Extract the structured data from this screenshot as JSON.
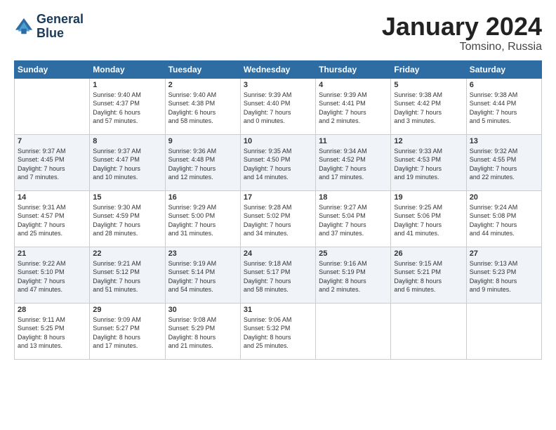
{
  "header": {
    "logo_line1": "General",
    "logo_line2": "Blue",
    "month": "January 2024",
    "location": "Tomsino, Russia"
  },
  "days_of_week": [
    "Sunday",
    "Monday",
    "Tuesday",
    "Wednesday",
    "Thursday",
    "Friday",
    "Saturday"
  ],
  "weeks": [
    [
      {
        "day": "",
        "info": ""
      },
      {
        "day": "1",
        "info": "Sunrise: 9:40 AM\nSunset: 4:37 PM\nDaylight: 6 hours\nand 57 minutes."
      },
      {
        "day": "2",
        "info": "Sunrise: 9:40 AM\nSunset: 4:38 PM\nDaylight: 6 hours\nand 58 minutes."
      },
      {
        "day": "3",
        "info": "Sunrise: 9:39 AM\nSunset: 4:40 PM\nDaylight: 7 hours\nand 0 minutes."
      },
      {
        "day": "4",
        "info": "Sunrise: 9:39 AM\nSunset: 4:41 PM\nDaylight: 7 hours\nand 2 minutes."
      },
      {
        "day": "5",
        "info": "Sunrise: 9:38 AM\nSunset: 4:42 PM\nDaylight: 7 hours\nand 3 minutes."
      },
      {
        "day": "6",
        "info": "Sunrise: 9:38 AM\nSunset: 4:44 PM\nDaylight: 7 hours\nand 5 minutes."
      }
    ],
    [
      {
        "day": "7",
        "info": "Sunrise: 9:37 AM\nSunset: 4:45 PM\nDaylight: 7 hours\nand 7 minutes."
      },
      {
        "day": "8",
        "info": "Sunrise: 9:37 AM\nSunset: 4:47 PM\nDaylight: 7 hours\nand 10 minutes."
      },
      {
        "day": "9",
        "info": "Sunrise: 9:36 AM\nSunset: 4:48 PM\nDaylight: 7 hours\nand 12 minutes."
      },
      {
        "day": "10",
        "info": "Sunrise: 9:35 AM\nSunset: 4:50 PM\nDaylight: 7 hours\nand 14 minutes."
      },
      {
        "day": "11",
        "info": "Sunrise: 9:34 AM\nSunset: 4:52 PM\nDaylight: 7 hours\nand 17 minutes."
      },
      {
        "day": "12",
        "info": "Sunrise: 9:33 AM\nSunset: 4:53 PM\nDaylight: 7 hours\nand 19 minutes."
      },
      {
        "day": "13",
        "info": "Sunrise: 9:32 AM\nSunset: 4:55 PM\nDaylight: 7 hours\nand 22 minutes."
      }
    ],
    [
      {
        "day": "14",
        "info": "Sunrise: 9:31 AM\nSunset: 4:57 PM\nDaylight: 7 hours\nand 25 minutes."
      },
      {
        "day": "15",
        "info": "Sunrise: 9:30 AM\nSunset: 4:59 PM\nDaylight: 7 hours\nand 28 minutes."
      },
      {
        "day": "16",
        "info": "Sunrise: 9:29 AM\nSunset: 5:00 PM\nDaylight: 7 hours\nand 31 minutes."
      },
      {
        "day": "17",
        "info": "Sunrise: 9:28 AM\nSunset: 5:02 PM\nDaylight: 7 hours\nand 34 minutes."
      },
      {
        "day": "18",
        "info": "Sunrise: 9:27 AM\nSunset: 5:04 PM\nDaylight: 7 hours\nand 37 minutes."
      },
      {
        "day": "19",
        "info": "Sunrise: 9:25 AM\nSunset: 5:06 PM\nDaylight: 7 hours\nand 41 minutes."
      },
      {
        "day": "20",
        "info": "Sunrise: 9:24 AM\nSunset: 5:08 PM\nDaylight: 7 hours\nand 44 minutes."
      }
    ],
    [
      {
        "day": "21",
        "info": "Sunrise: 9:22 AM\nSunset: 5:10 PM\nDaylight: 7 hours\nand 47 minutes."
      },
      {
        "day": "22",
        "info": "Sunrise: 9:21 AM\nSunset: 5:12 PM\nDaylight: 7 hours\nand 51 minutes."
      },
      {
        "day": "23",
        "info": "Sunrise: 9:19 AM\nSunset: 5:14 PM\nDaylight: 7 hours\nand 54 minutes."
      },
      {
        "day": "24",
        "info": "Sunrise: 9:18 AM\nSunset: 5:17 PM\nDaylight: 7 hours\nand 58 minutes."
      },
      {
        "day": "25",
        "info": "Sunrise: 9:16 AM\nSunset: 5:19 PM\nDaylight: 8 hours\nand 2 minutes."
      },
      {
        "day": "26",
        "info": "Sunrise: 9:15 AM\nSunset: 5:21 PM\nDaylight: 8 hours\nand 6 minutes."
      },
      {
        "day": "27",
        "info": "Sunrise: 9:13 AM\nSunset: 5:23 PM\nDaylight: 8 hours\nand 9 minutes."
      }
    ],
    [
      {
        "day": "28",
        "info": "Sunrise: 9:11 AM\nSunset: 5:25 PM\nDaylight: 8 hours\nand 13 minutes."
      },
      {
        "day": "29",
        "info": "Sunrise: 9:09 AM\nSunset: 5:27 PM\nDaylight: 8 hours\nand 17 minutes."
      },
      {
        "day": "30",
        "info": "Sunrise: 9:08 AM\nSunset: 5:29 PM\nDaylight: 8 hours\nand 21 minutes."
      },
      {
        "day": "31",
        "info": "Sunrise: 9:06 AM\nSunset: 5:32 PM\nDaylight: 8 hours\nand 25 minutes."
      },
      {
        "day": "",
        "info": ""
      },
      {
        "day": "",
        "info": ""
      },
      {
        "day": "",
        "info": ""
      }
    ]
  ]
}
